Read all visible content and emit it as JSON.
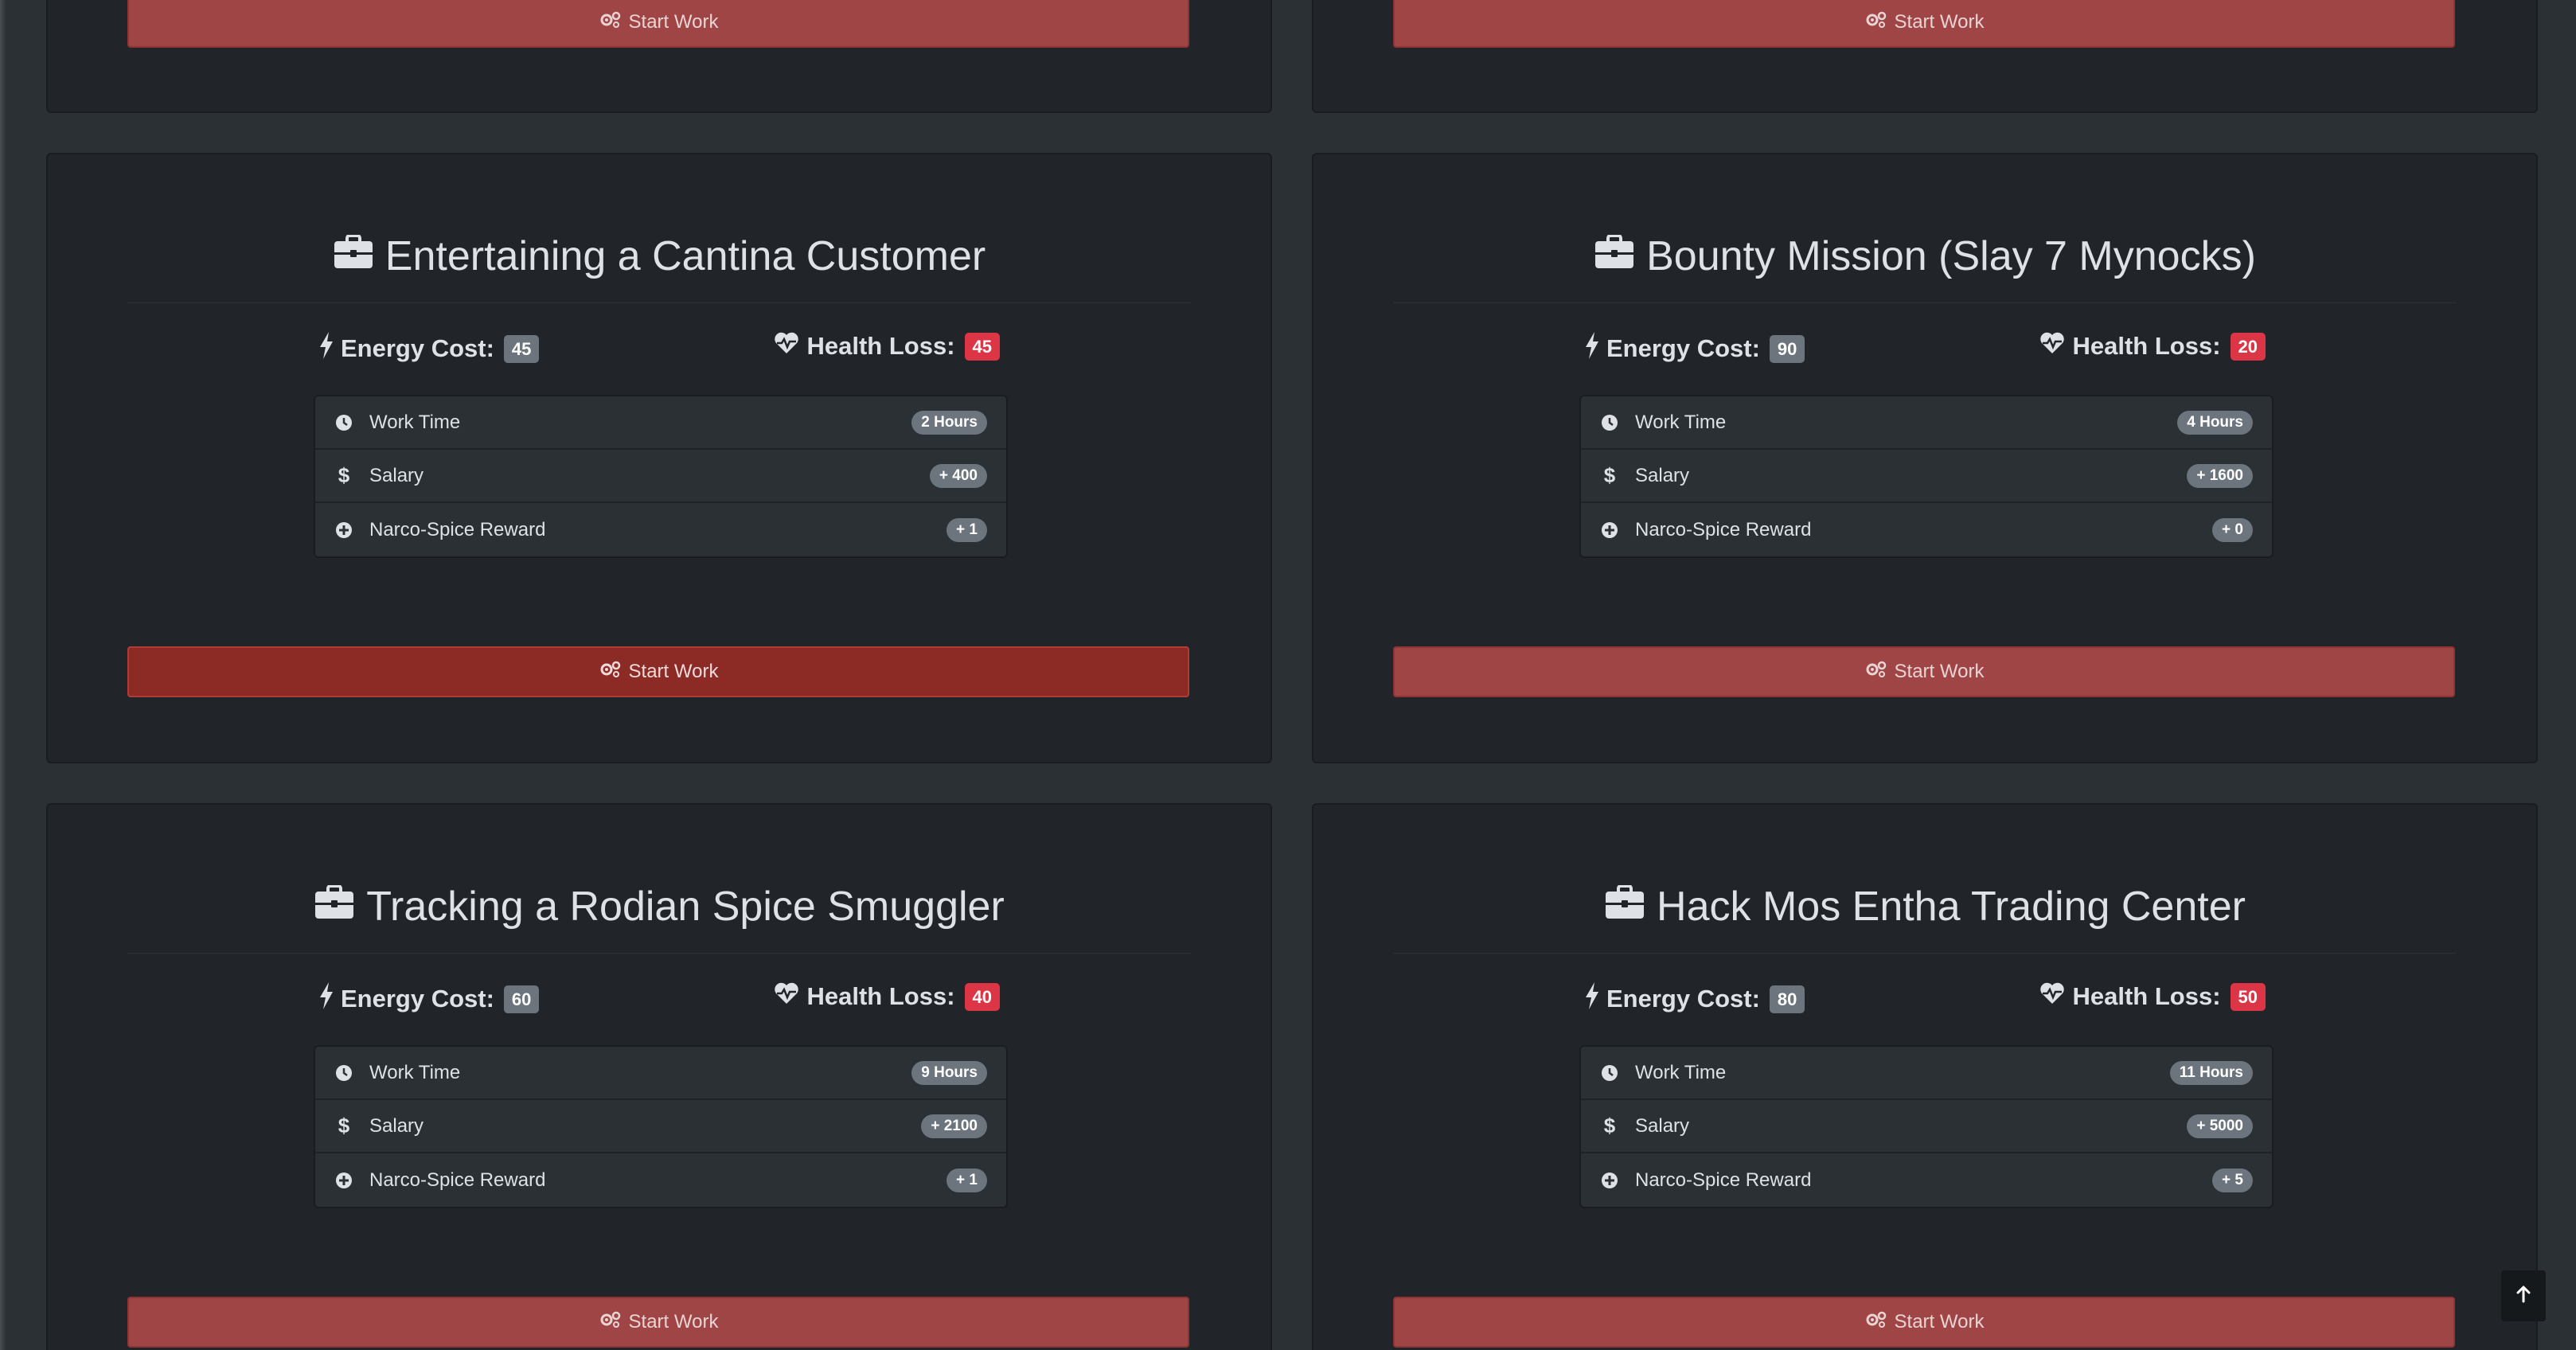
{
  "button_label": "Start Work",
  "labels": {
    "energy": "Energy Cost:",
    "health": "Health Loss:",
    "work_time": "Work Time",
    "salary": "Salary",
    "reward": "Narco-Spice Reward"
  },
  "jobs": [
    {
      "title": "Entertaining a Cantina Customer",
      "energy": "45",
      "health": "45",
      "work_time": "2 Hours",
      "salary": "+ 400",
      "reward": "+ 1"
    },
    {
      "title": "Bounty Mission (Slay 7 Mynocks)",
      "energy": "90",
      "health": "20",
      "work_time": "4 Hours",
      "salary": "+ 1600",
      "reward": "+ 0"
    },
    {
      "title": "Tracking a Rodian Spice Smuggler",
      "energy": "60",
      "health": "40",
      "work_time": "9 Hours",
      "salary": "+ 2100",
      "reward": "+ 1"
    },
    {
      "title": "Hack Mos Entha Trading Center",
      "energy": "80",
      "health": "50",
      "work_time": "11 Hours",
      "salary": "+ 5000",
      "reward": "+ 5"
    }
  ],
  "icons": {
    "title": "briefcase-icon",
    "energy": "bolt-icon",
    "health": "heartbeat-icon",
    "work_time": "clock-icon",
    "salary": "dollar-icon",
    "reward": "plus-circle-icon",
    "button": "cogs-icon",
    "scroll": "arrow-up-icon"
  },
  "colors": {
    "page_bg": "#2b3035",
    "card_bg": "#212529",
    "button": "#a04545",
    "button_active": "#8c2a26",
    "badge_red": "#dc3545",
    "badge_gray": "#6c757d"
  }
}
